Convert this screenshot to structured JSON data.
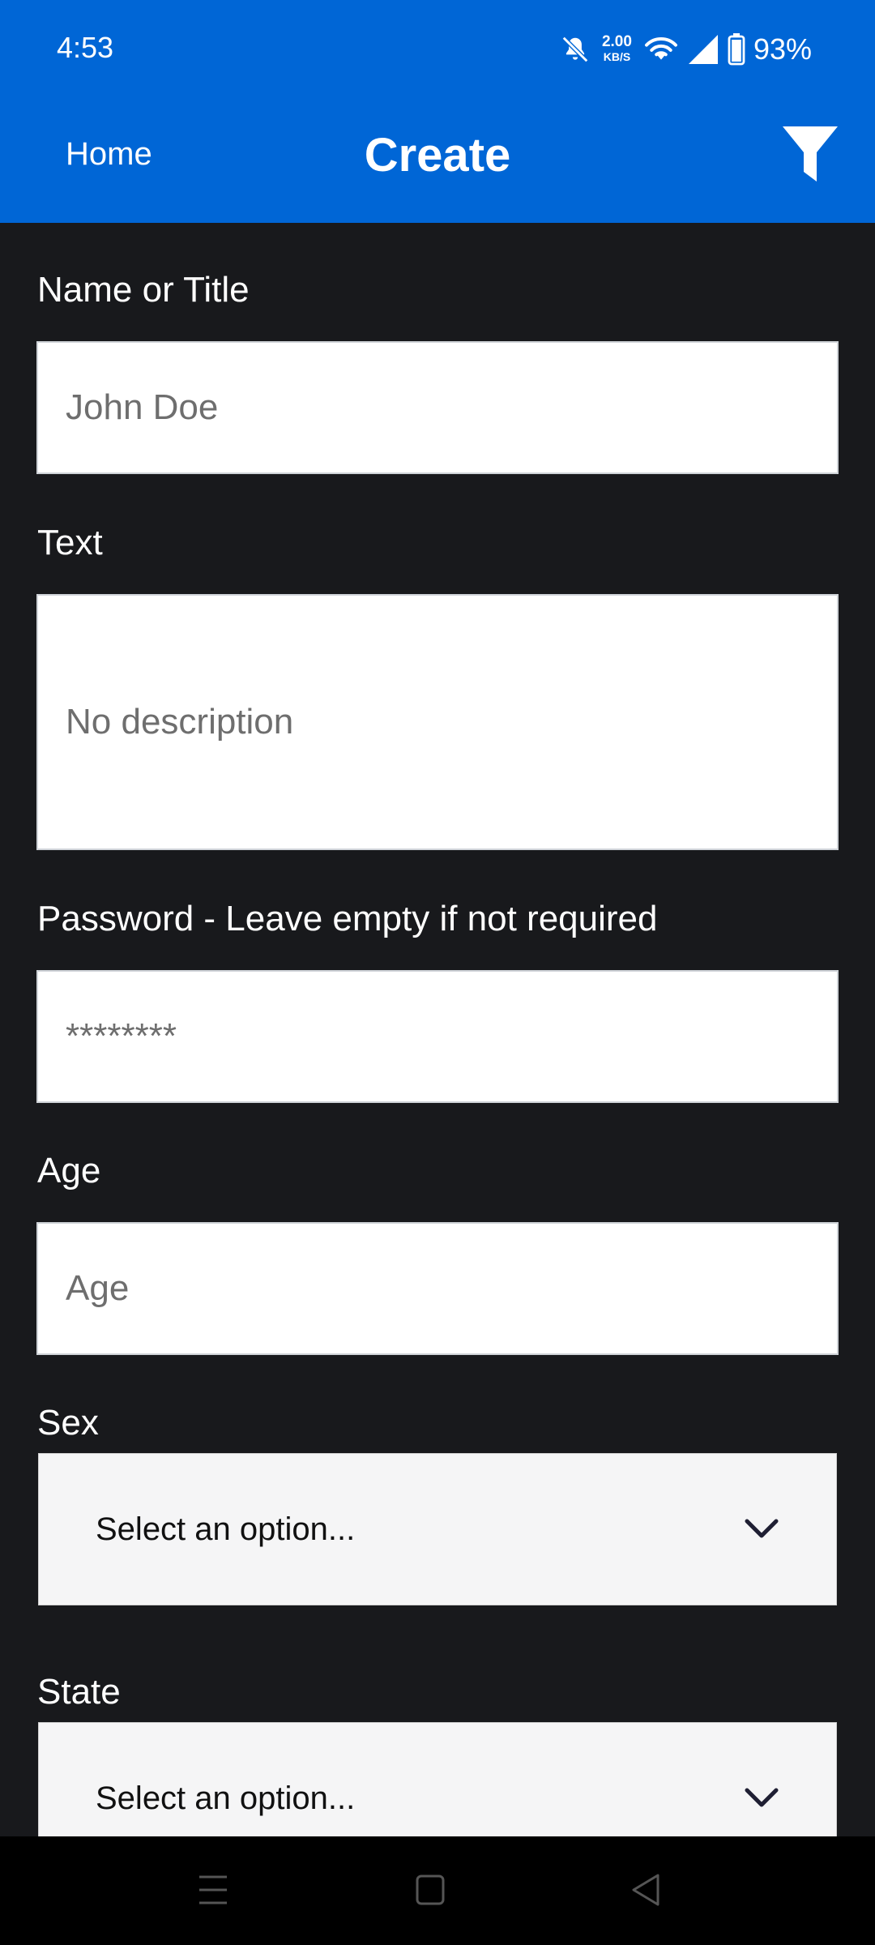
{
  "status_bar": {
    "time": "4:53",
    "net_speed_value": "2.00",
    "net_speed_unit": "KB/S",
    "battery": "93%",
    "icons": [
      "mute-icon",
      "wifi-icon",
      "signal-icon",
      "battery-icon"
    ]
  },
  "app_bar": {
    "home_label": "Home",
    "title": "Create",
    "filter_icon": "filter-icon",
    "color": "#0066d6"
  },
  "form": {
    "name": {
      "label": "Name or Title",
      "placeholder": "John Doe"
    },
    "text": {
      "label": "Text",
      "placeholder": "No description"
    },
    "password": {
      "label": "Password - Leave empty if not required",
      "placeholder": "********"
    },
    "age": {
      "label": "Age",
      "placeholder": "Age"
    },
    "sex": {
      "label": "Sex",
      "selected": "Select an option..."
    },
    "state": {
      "label": "State",
      "selected": "Select an option..."
    }
  },
  "nav_bar": {
    "icons": [
      "menu-icon",
      "home-square-icon",
      "back-icon"
    ]
  }
}
